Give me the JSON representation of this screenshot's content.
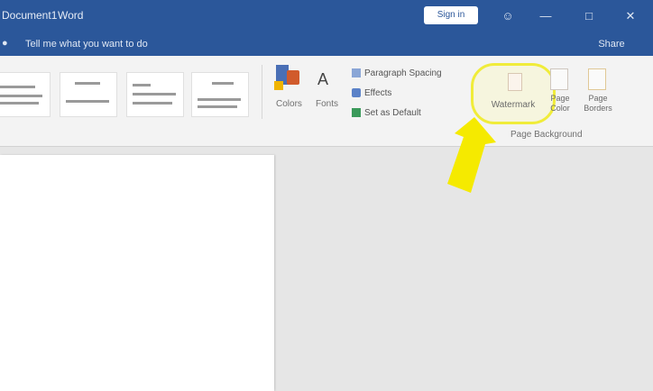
{
  "titlebar": {
    "doc_title": "Document1",
    "app_name": "Word",
    "signin_label": "Sign in",
    "icons": [
      "people-icon",
      "minimize-icon",
      "maximize-icon",
      "close-icon"
    ],
    "icon_glyphs": [
      "☺",
      "—",
      "□",
      "✕"
    ]
  },
  "tellbar": {
    "tell_placeholder": "Tell me what you want to do",
    "share_label": "Share"
  },
  "ribbon": {
    "colors_label": "Colors",
    "fonts_label": "Fonts",
    "paragraph_spacing_label": "Paragraph Spacing",
    "effects_label": "Effects",
    "set_default_label": "Set as Default",
    "watermark_label": "Watermark",
    "page_color_label": "Page Color",
    "page_borders_label": "Page Borders",
    "group_label": "Page Background"
  },
  "colors": {
    "titlebar": "#2b579a",
    "highlight": "#f0ec3a",
    "arrow": "#f5ea00"
  }
}
